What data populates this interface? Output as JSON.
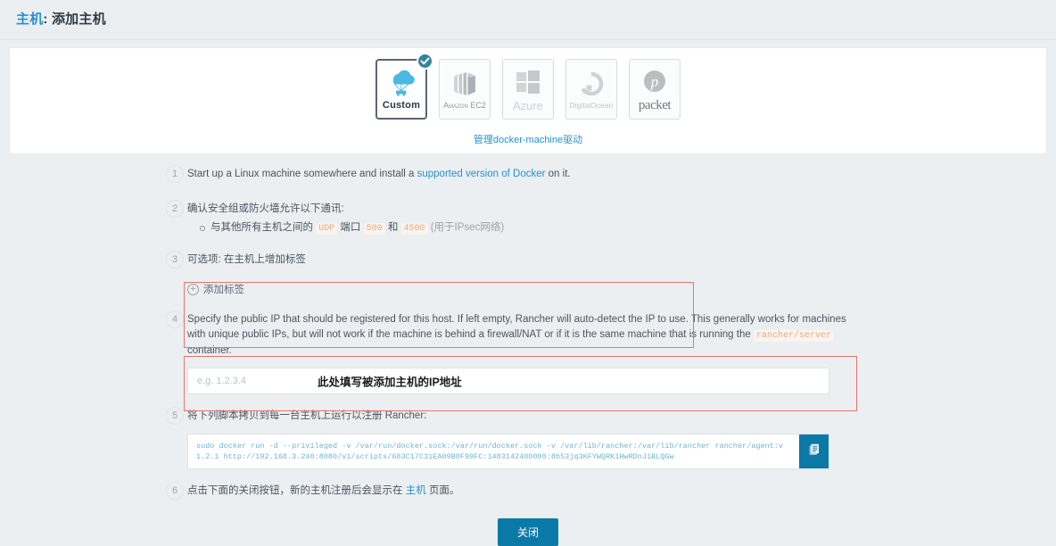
{
  "header": {
    "title_prefix": "主机",
    "title_sep": ": ",
    "title_suffix": "添加主机"
  },
  "drivers": {
    "manage_link": "管理docker-machine驱动",
    "check_icon": "check-icon",
    "items": [
      {
        "id": "custom",
        "label": "Custom",
        "icon": "cloud-parachute-icon",
        "selected": true
      },
      {
        "id": "amazon-ec2",
        "label": "Amazon EC2",
        "icon": "amazon-ec2-icon",
        "selected": false
      },
      {
        "id": "azure",
        "label": "Azure",
        "icon": "windows-azure-icon",
        "selected": false
      },
      {
        "id": "digitalocean",
        "label": "DigitalOcean",
        "icon": "digitalocean-icon",
        "selected": false
      },
      {
        "id": "packet",
        "label": "packet",
        "icon": "packet-icon",
        "selected": false
      }
    ]
  },
  "steps": {
    "n1": "1",
    "n2": "2",
    "n3": "3",
    "n4": "4",
    "n5": "5",
    "n6": "6",
    "step1": {
      "text_before": "Start up a Linux machine somewhere and install a ",
      "link": "supported version of Docker",
      "text_after": " on it."
    },
    "step2": {
      "heading": "确认安全组或防火墙允许以下通讯:",
      "bullet_before": "与其他所有主机之间的 ",
      "code_udp": "UDP",
      "bullet_mid1": " 端口 ",
      "code_500": "500",
      "bullet_mid2": " 和 ",
      "code_4500": "4500",
      "bullet_after": " (用于IPsec网络)"
    },
    "step3": {
      "heading": "可选项: 在主机上增加标签",
      "add_label_button": "添加标签",
      "plus_icon": "plus-circle-icon"
    },
    "step4": {
      "text_before": "Specify the public IP that should be registered for this host. If left empty, Rancher will auto-detect the IP to use. This generally works for machines with unique public IPs, but will not work if the machine is behind a firewall/NAT or if it is the same machine that is running the ",
      "code": "rancher/server",
      "text_after": " container.",
      "input_placeholder": "e.g. 1.2.3.4",
      "input_value": "",
      "annotation": "此处填写被添加主机的IP地址"
    },
    "step5": {
      "heading": "将下列脚本拷贝到每一台主机上运行以注册 Rancher:",
      "script": "sudo docker run -d --privileged -v /var/run/docker.sock:/var/run/docker.sock -v /var/lib/rancher:/var/lib/rancher rancher/agent:v1.2.1 http://192.168.3.240:8080/v1/scripts/683C17C31EA09B0F99FC:1483142400000:8b53jq3KFYWQRK1HwRDnJ1BLQGw",
      "copy_icon": "clipboard-copy-icon"
    },
    "step6": {
      "text_before": "点击下面的关闭按钮，新的主机注册后会显示在 ",
      "link": "主机",
      "text_after": " 页面。"
    }
  },
  "footer": {
    "close_button": "关闭"
  },
  "colors": {
    "accent_blue": "#2491cd",
    "button_teal": "#0b79a8",
    "check_teal": "#31859b",
    "annotation_red": "#e8736e",
    "code_orange": "#e8a87c",
    "script_blue": "#6fb4cf",
    "page_bg": "#eceff1"
  }
}
